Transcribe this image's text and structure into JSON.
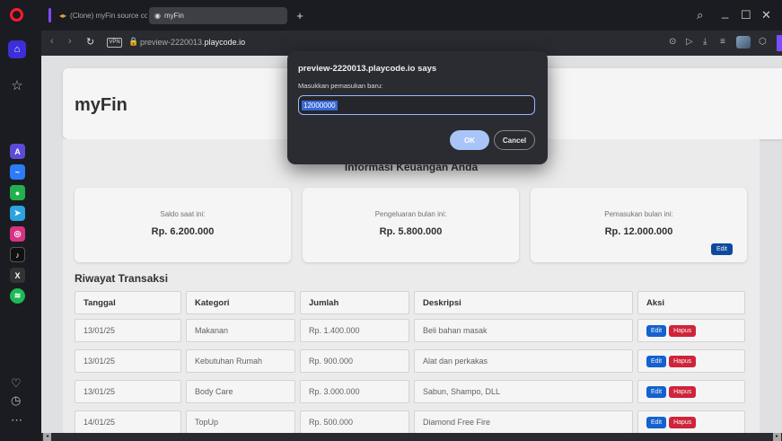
{
  "browser": {
    "tabs": [
      {
        "label": "(Clone) myFin source cod"
      },
      {
        "label": "myFin"
      }
    ],
    "new_tab": "+",
    "window_controls": {
      "search": "⌕",
      "minimize": "_",
      "maximize": "☐",
      "close": "✕"
    },
    "vpn_label": "VPN",
    "url_prefix": "preview-2220013.",
    "url_domain": "playcode.io"
  },
  "page": {
    "brand": "myFin",
    "section_title": "Informasi Keuangan Anda",
    "summary": [
      {
        "label": "Saldo saat ini:",
        "value": "Rp. 6.200.000"
      },
      {
        "label": "Pengeluaran bulan ini:",
        "value": "Rp. 5.800.000"
      },
      {
        "label": "Pemasukan bulan ini:",
        "value": "Rp. 12.000.000",
        "edit_label": "Edit"
      }
    ],
    "history_title": "Riwayat Transaksi",
    "columns": [
      "Tanggal",
      "Kategori",
      "Jumlah",
      "Deskripsi",
      "Aksi"
    ],
    "rows": [
      [
        "13/01/25",
        "Makanan",
        "Rp. 1.400.000",
        "Beli bahan masak"
      ],
      [
        "13/01/25",
        "Kebutuhan Rumah",
        "Rp. 900.000",
        "Alat dan perkakas"
      ],
      [
        "13/01/25",
        "Body Care",
        "Rp. 3.000.000",
        "Sabun, Shampo, DLL"
      ],
      [
        "14/01/25",
        "TopUp",
        "Rp. 500.000",
        "Diamond Free Fire"
      ]
    ],
    "row_edit_label": "Edit",
    "row_delete_label": "Hapus"
  },
  "dialog": {
    "title": "preview-2220013.playcode.io says",
    "message": "Masukkan pemasukan baru:",
    "input_value": "12000000",
    "ok_label": "OK",
    "cancel_label": "Cancel"
  },
  "colors": {
    "accent": "#7c4dff",
    "edit_button": "#1565d8",
    "delete_button": "#d8263d",
    "dialog_bg": "#2b2c31"
  }
}
